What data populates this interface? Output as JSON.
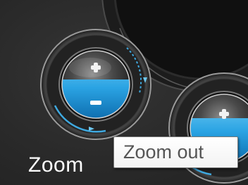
{
  "zoom_control": {
    "label": "Zoom",
    "zoom_in_icon": "plus-icon",
    "zoom_out_icon": "minus-icon",
    "accent_color": "#3fa9e0",
    "ring_color": "#6ec8f0"
  },
  "tooltip": {
    "text": "Zoom out"
  }
}
